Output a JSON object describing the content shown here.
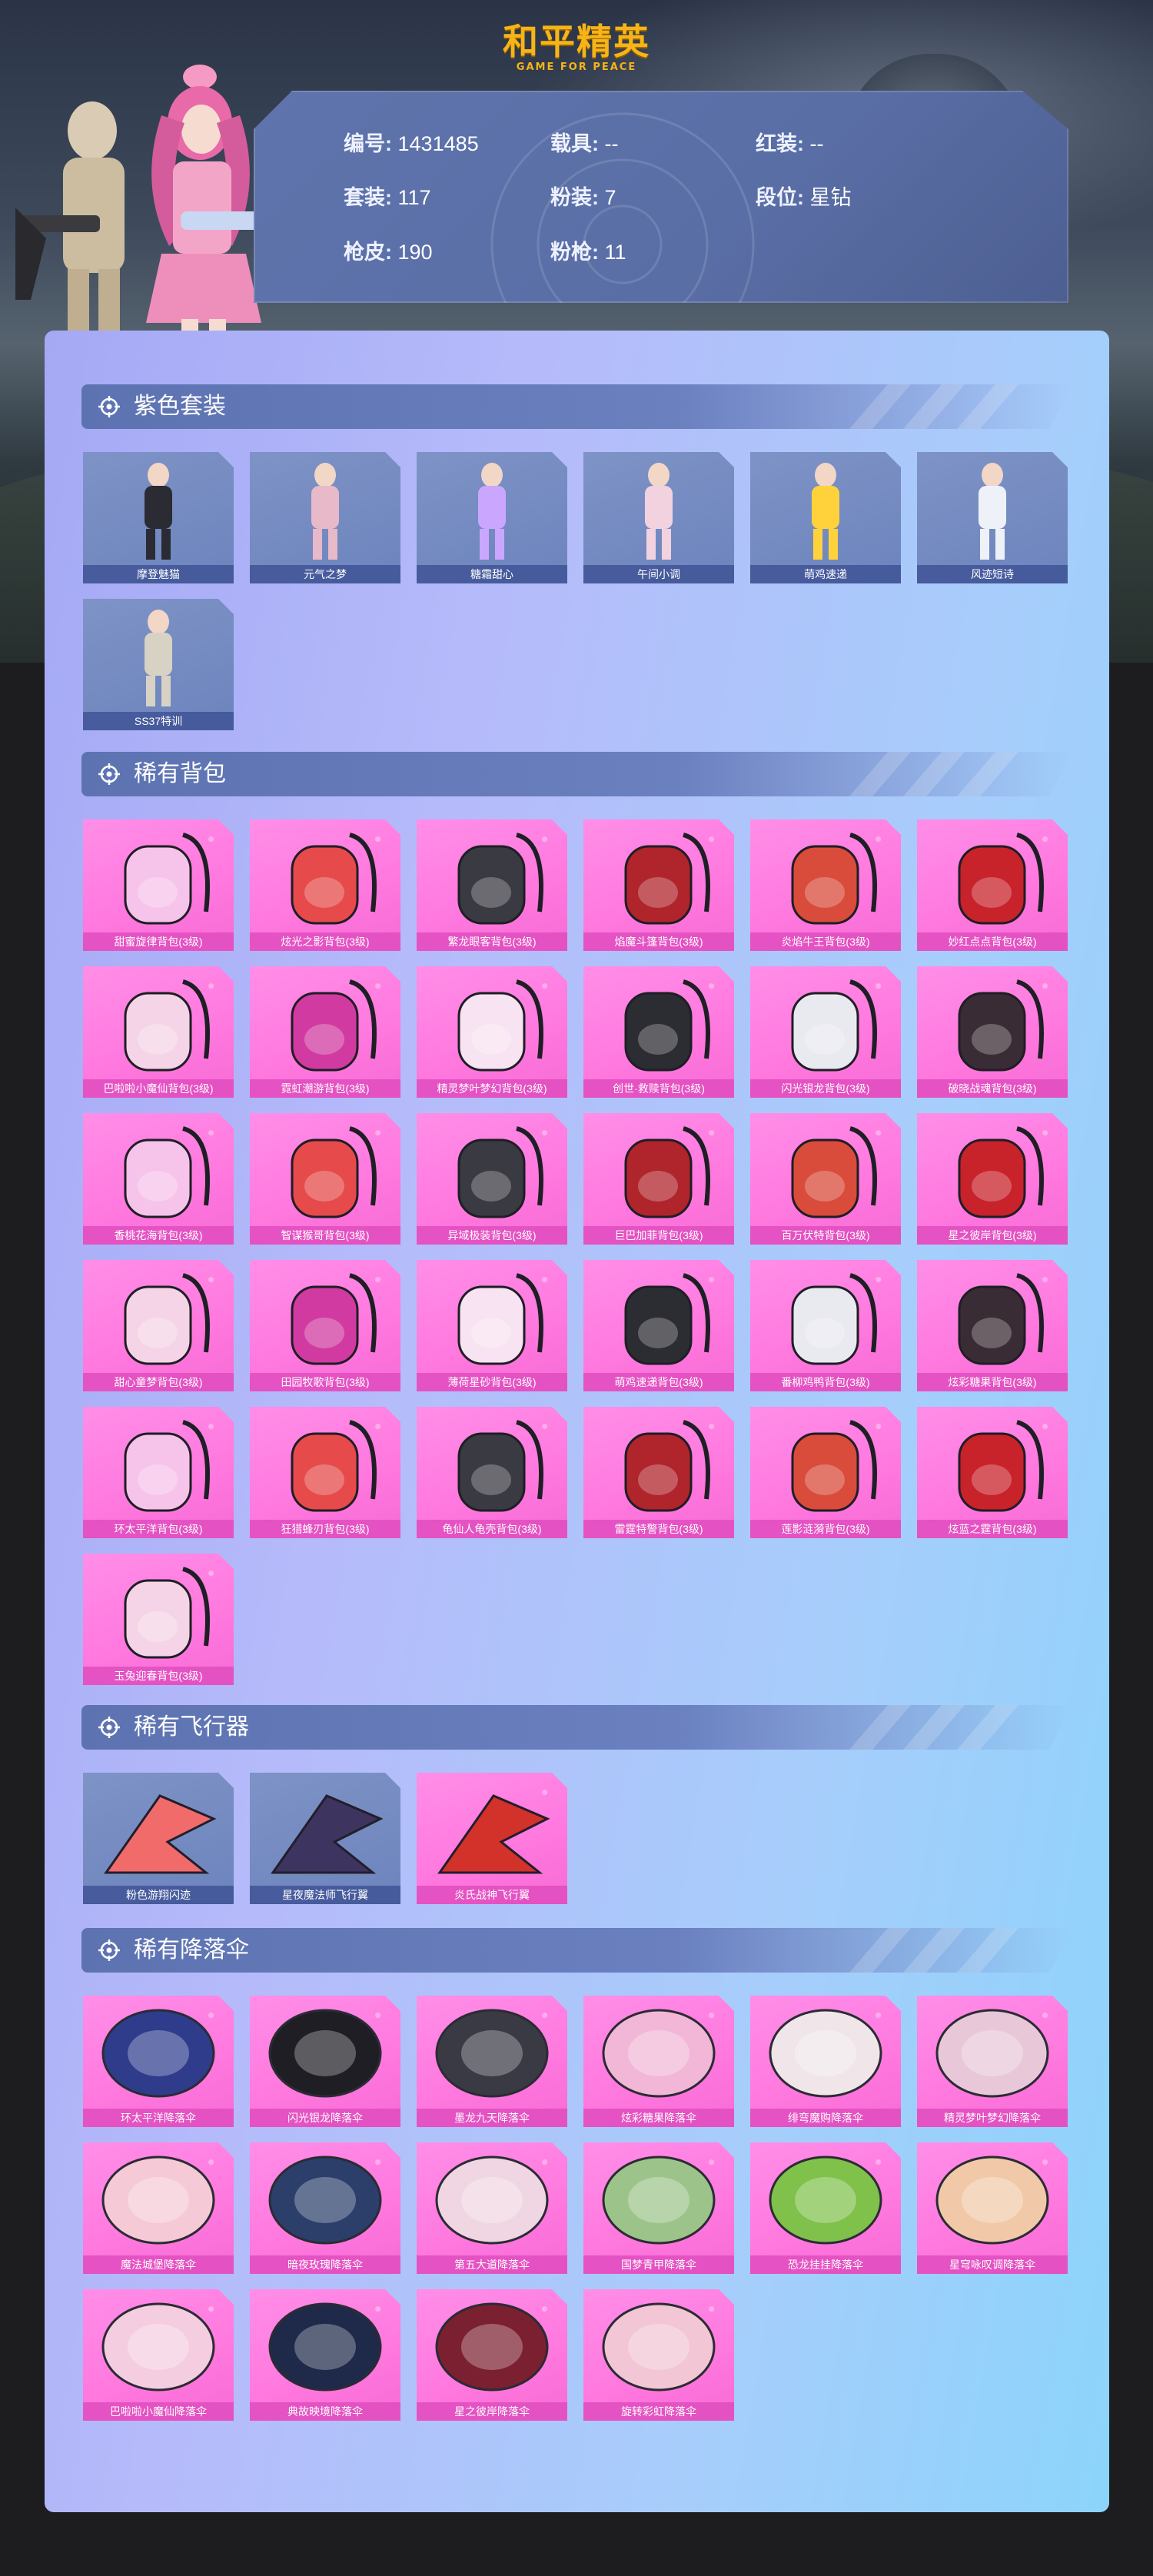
{
  "header": {
    "logo_main": "和平精英",
    "logo_sub": "GAME FOR PEACE"
  },
  "stats": [
    {
      "label": "编号:",
      "value": "1431485"
    },
    {
      "label": "载具:",
      "value": "--"
    },
    {
      "label": "红装:",
      "value": "--"
    },
    {
      "label": "套装:",
      "value": "117"
    },
    {
      "label": "粉装:",
      "value": "7"
    },
    {
      "label": "段位:",
      "value": "星钻"
    },
    {
      "label": "枪皮:",
      "value": "190"
    },
    {
      "label": "粉枪:",
      "value": "11"
    }
  ],
  "sections": [
    {
      "title": "紫色套装",
      "item_color": "#7e93c6",
      "icon": "outfit-icon",
      "items": [
        "摩登魅猫",
        "元气之梦",
        "糖霜甜心",
        "午间小调",
        "萌鸡速递",
        "风迹短诗",
        "SS37特训"
      ]
    },
    {
      "title": "稀有背包",
      "item_color": "#ff8ee8",
      "icon": "backpack-icon",
      "items": [
        "甜蜜旋律背包(3级)",
        "炫光之影背包(3级)",
        "繁龙眼客背包(3级)",
        "焰魔斗篷背包(3级)",
        "炎焰牛王背包(3级)",
        "妙红点点背包(3级)",
        "巴啦啦小魔仙背包(3级)",
        "霓虹潮游背包(3级)",
        "精灵梦叶梦幻背包(3级)",
        "创世·救赎背包(3级)",
        "闪光银龙背包(3级)",
        "破晓战魂背包(3级)",
        "香桃花海背包(3级)",
        "智谋猴哥背包(3级)",
        "异域极装背包(3级)",
        "巨巴加菲背包(3级)",
        "百万伏特背包(3级)",
        "星之彼岸背包(3级)",
        "甜心童梦背包(3级)",
        "田园牧歌背包(3级)",
        "薄荷星砂背包(3级)",
        "萌鸡速递背包(3级)",
        "番柳鸡鸭背包(3级)",
        "炫彩糖果背包(3级)",
        "环太平洋背包(3级)",
        "狂猎蜂刃背包(3级)",
        "龟仙人龟壳背包(3级)",
        "雷霆特警背包(3级)",
        "莲影涟漪背包(3级)",
        "炫蓝之霆背包(3级)",
        "玉兔迎春背包(3级)"
      ]
    },
    {
      "title": "稀有飞行器",
      "item_color": "#ff8ee8",
      "icon": "glider-icon",
      "items": [
        "粉色游翔闪迹",
        "星夜魔法师飞行翼",
        "炎氏战神飞行翼"
      ]
    },
    {
      "title": "稀有降落伞",
      "item_color": "#ff8ee8",
      "icon": "parachute-icon",
      "items": [
        "环太平洋降落伞",
        "闪光银龙降落伞",
        "墨龙九天降落伞",
        "炫彩糖果降落伞",
        "绯弯魔购降落伞",
        "精灵梦叶梦幻降落伞",
        "魔法城堡降落伞",
        "暗夜玫瑰降落伞",
        "第五大道降落伞",
        "国梦青甲降落伞",
        "恐龙挂挂降落伞",
        "星穹咏叹调降落伞",
        "巴啦啦小魔仙降落伞",
        "典故映境降落伞",
        "星之彼岸降落伞",
        "旋转彩虹降落伞"
      ]
    }
  ]
}
